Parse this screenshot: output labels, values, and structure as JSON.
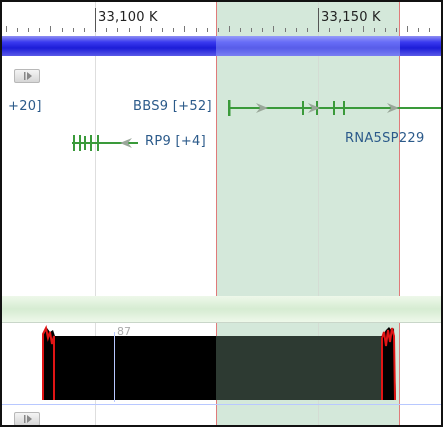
{
  "ruler": {
    "ticks": [
      {
        "label": "33,100 K",
        "position_kb": 33100
      },
      {
        "label": "33,150 K",
        "position_kb": 33150
      }
    ]
  },
  "genes": [
    {
      "id": "left-gene",
      "label": "+20]"
    },
    {
      "id": "bbs9",
      "label": "BBS9 [+52]",
      "strand": "+"
    },
    {
      "id": "rp9",
      "label": "RP9 [+4]",
      "strand": "-"
    },
    {
      "id": "rnasp",
      "label": "RNA5SP229"
    }
  ],
  "coverage_track": {
    "label": "87"
  },
  "colors": {
    "chromosome_bar": "#3333ee",
    "gene": "#3a9a3a",
    "highlight_region": "#cfe6d4",
    "highlight_border": "#e07070",
    "coverage_fill": "#000000",
    "coverage_edge": "#dd1111",
    "track_divider": "#dcefd9"
  },
  "icons": [
    "expand-track-icon",
    "expand-track-icon"
  ]
}
